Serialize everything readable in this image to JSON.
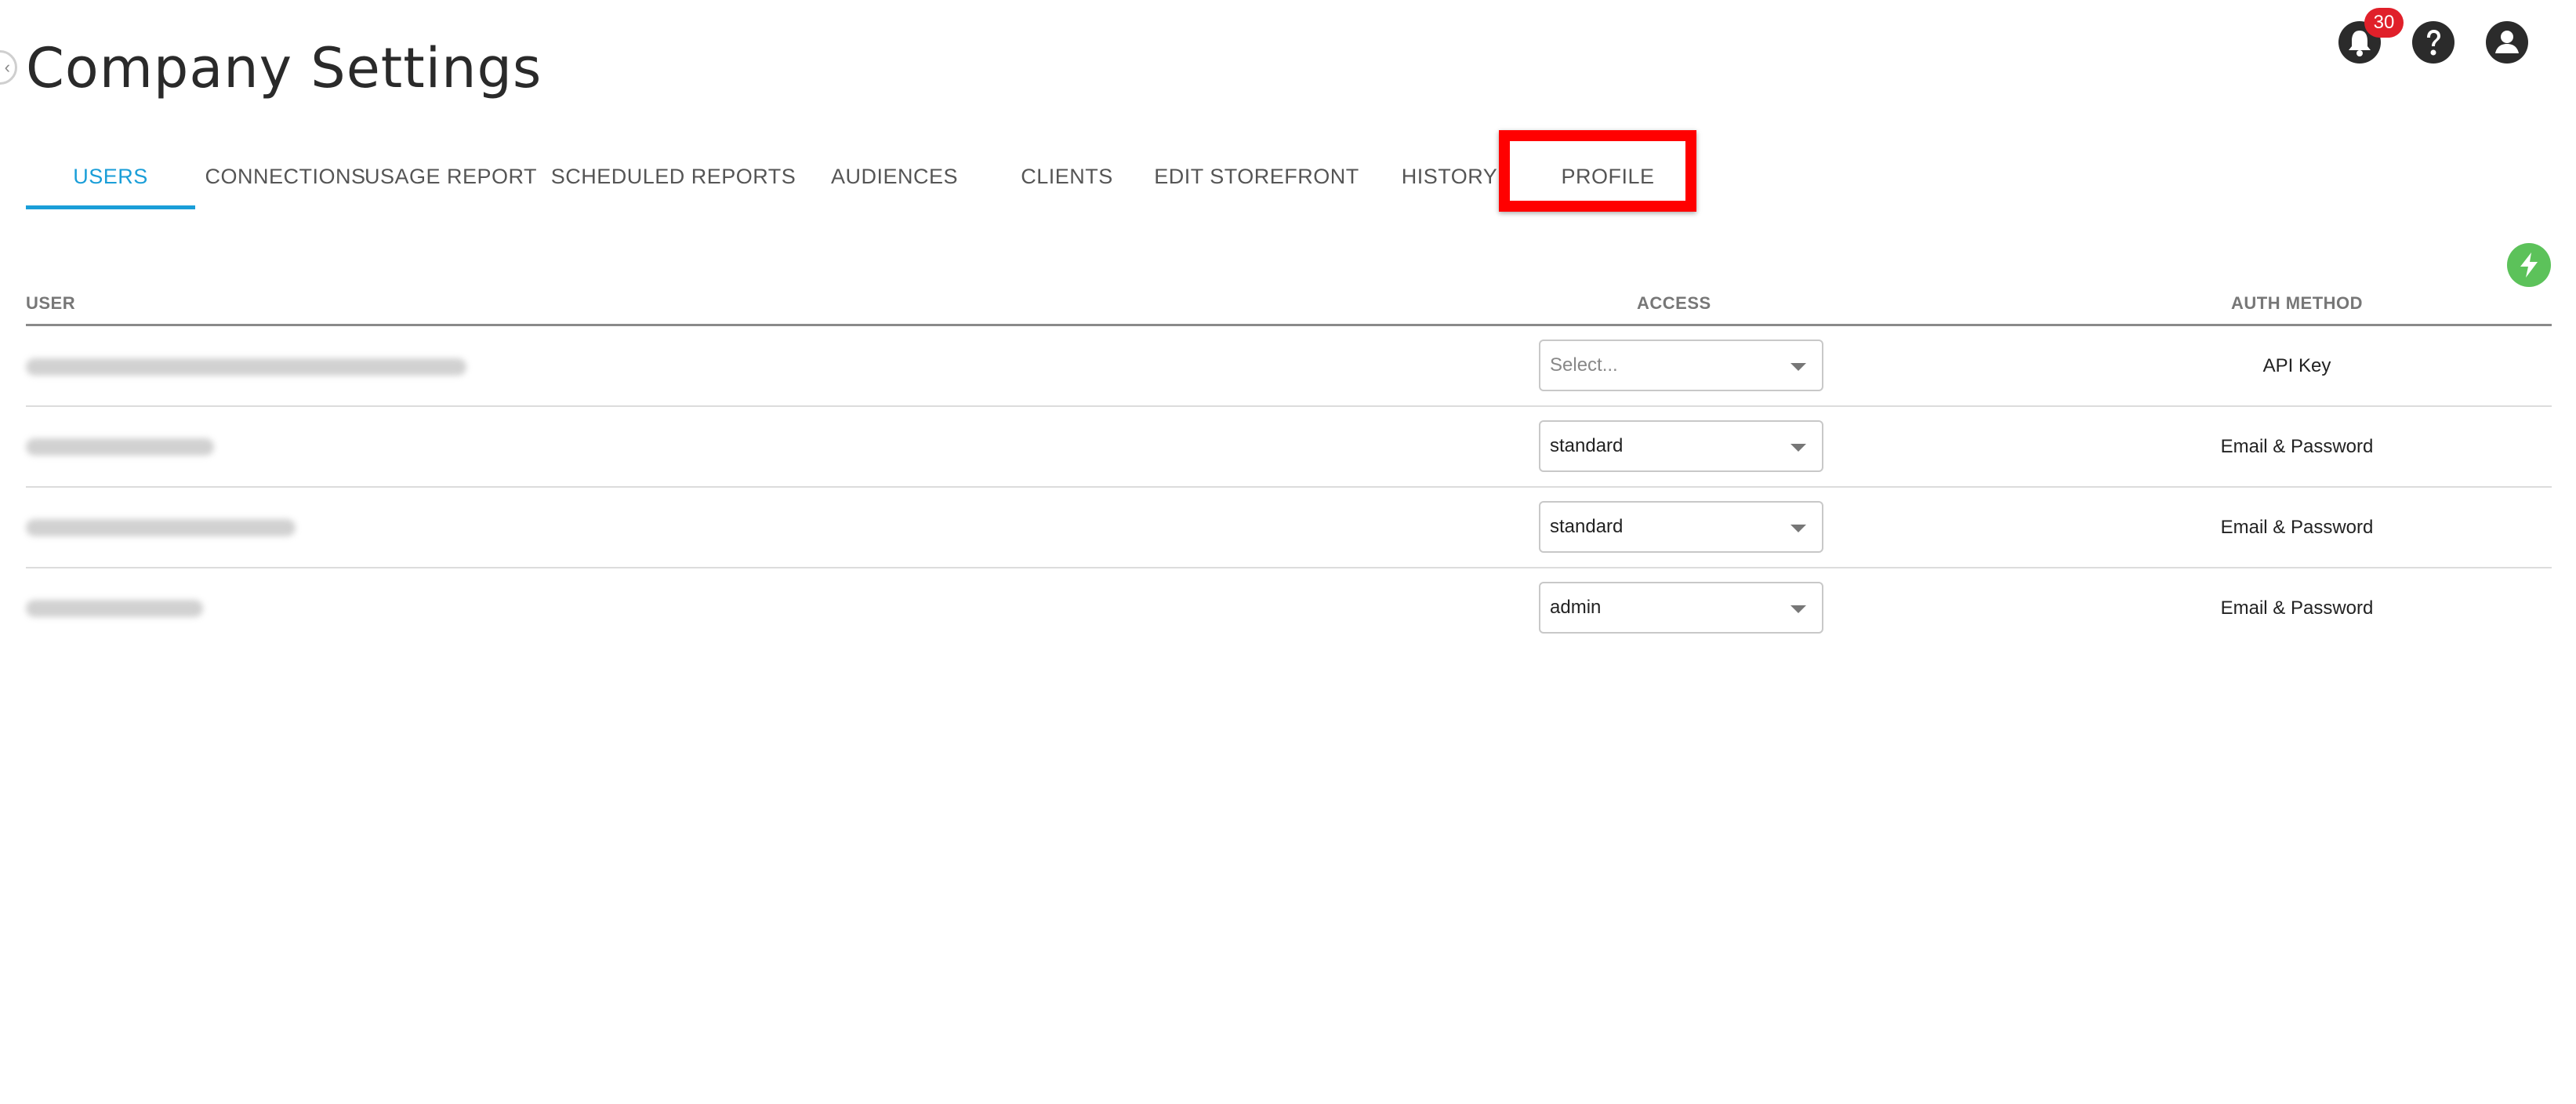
{
  "page": {
    "title": "Company Settings"
  },
  "header": {
    "notification_count": "30",
    "icons": [
      "bell-icon",
      "help-icon",
      "account-icon"
    ]
  },
  "tabs": [
    {
      "label": "USERS",
      "active": true
    },
    {
      "label": "CONNECTIONS"
    },
    {
      "label": "USAGE REPORT"
    },
    {
      "label": "SCHEDULED REPORTS"
    },
    {
      "label": "AUDIENCES"
    },
    {
      "label": "CLIENTS"
    },
    {
      "label": "EDIT STOREFRONT"
    },
    {
      "label": "HISTORY"
    },
    {
      "label": "PROFILE",
      "highlighted": true
    }
  ],
  "table": {
    "columns": {
      "user": "USER",
      "access": "ACCESS",
      "auth_method": "AUTH METHOD"
    },
    "rows": [
      {
        "access": "Select...",
        "auth_method": "API Key"
      },
      {
        "access": "standard",
        "auth_method": "Email & Password"
      },
      {
        "access": "standard",
        "auth_method": "Email & Password"
      },
      {
        "access": "admin",
        "auth_method": "Email & Password"
      }
    ]
  },
  "colors": {
    "accent": "#1a9ed8",
    "highlight": "#ff0000",
    "badge": "#e0202a",
    "action": "#5cc25a"
  }
}
